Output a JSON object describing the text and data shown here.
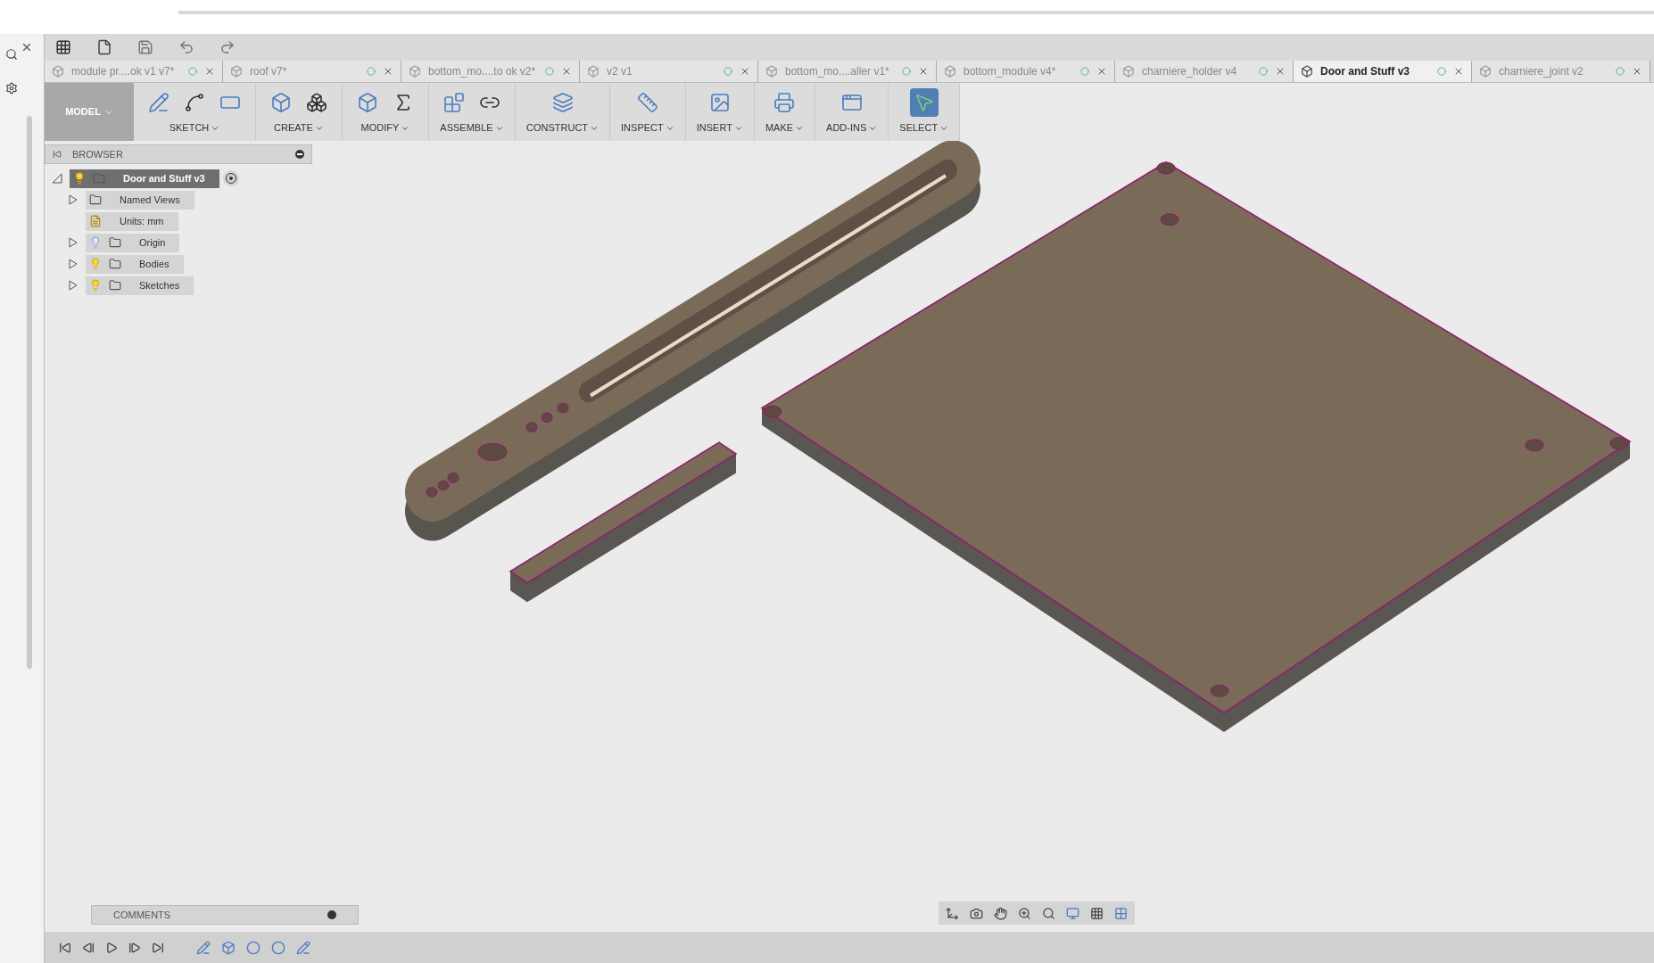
{
  "tabs": [
    {
      "label": "module pr....ok v1 v7*",
      "selected": false
    },
    {
      "label": "roof v7*",
      "selected": false
    },
    {
      "label": "bottom_mo....to ok v2*",
      "selected": false
    },
    {
      "label": "v2 v1",
      "selected": false
    },
    {
      "label": "bottom_mo....aller v1*",
      "selected": false
    },
    {
      "label": "bottom_module v4*",
      "selected": false
    },
    {
      "label": "charniere_holder v4",
      "selected": false
    },
    {
      "label": "Door and Stuff v3",
      "selected": true
    },
    {
      "label": "charniere_joint v2",
      "selected": false
    }
  ],
  "workspace": {
    "label": "MODEL"
  },
  "toolbar_groups": [
    {
      "kind": "sketch",
      "label": "SKETCH",
      "selected": false
    },
    {
      "kind": "create",
      "label": "CREATE",
      "selected": false
    },
    {
      "kind": "modify",
      "label": "MODIFY",
      "selected": false
    },
    {
      "kind": "assemble",
      "label": "ASSEMBLE",
      "selected": false
    },
    {
      "kind": "construct",
      "label": "CONSTRUCT",
      "selected": false
    },
    {
      "kind": "inspect",
      "label": "INSPECT",
      "selected": false
    },
    {
      "kind": "insert",
      "label": "INSERT",
      "selected": false
    },
    {
      "kind": "make",
      "label": "MAKE",
      "selected": false
    },
    {
      "kind": "addins",
      "label": "ADD-INS",
      "selected": false
    },
    {
      "kind": "select",
      "label": "SELECT",
      "selected": true
    }
  ],
  "browser": {
    "title": "BROWSER",
    "root": {
      "label": "Door and Stuff v3",
      "visible": true,
      "expanded": true,
      "selected": true,
      "children": [
        {
          "kind": "folder",
          "label": "Named Views",
          "expanded": false,
          "selected": false
        },
        {
          "kind": "units",
          "label": "Units: mm",
          "selected": false
        },
        {
          "kind": "folder",
          "label": "Origin",
          "visible": false,
          "expanded": false,
          "selected": false
        },
        {
          "kind": "folder",
          "label": "Bodies",
          "visible": true,
          "expanded": false,
          "selected": false
        },
        {
          "kind": "folder",
          "label": "Sketches",
          "visible": true,
          "expanded": false,
          "selected": false
        }
      ]
    }
  },
  "comments": {
    "title": "COMMENTS"
  }
}
